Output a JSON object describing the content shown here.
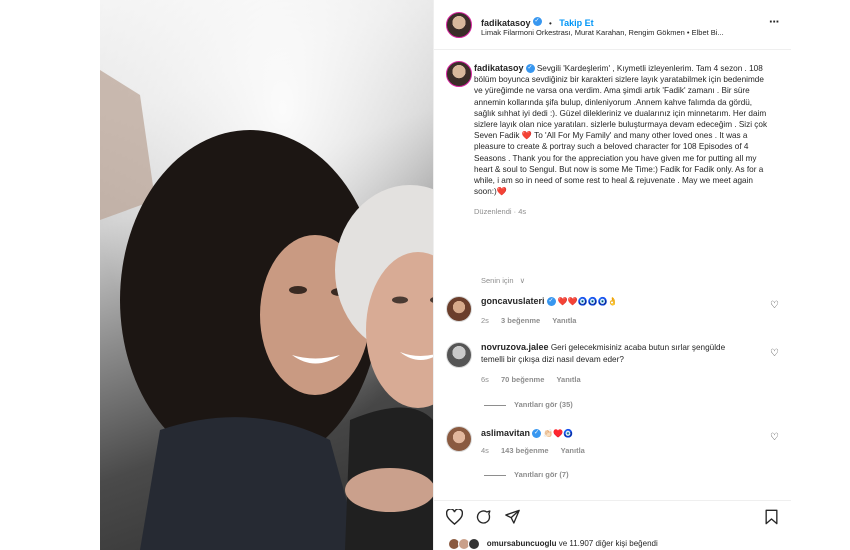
{
  "post": {
    "author": "fadikatasoy",
    "follow_label": "Takip Et",
    "separator": "•",
    "location": "Limak Filarmoni Orkestrası, Murat Karahan, Rengim Gökmen • Elbet Bi...",
    "more_label": "···",
    "caption": "Sevgili 'Kardeşlerim' , Kıymetli izleyenlerim. Tam 4 sezon . 108 bölüm boyunca sevdiğiniz bir karakteri sizlere layık yaratabilmek için bedenimde ve yüreğimde ne varsa ona verdim. Ama şimdi artık 'Fadik' zamanı . Bir süre annemin kollarında şifa bulup, dinleniyorum .Annem kahve falımda da gördü, sağlık sıhhat iyi dedi :). Güzel dilekleriniz ve dualarınız için minnetarım. Her daim sizlere layık olan nice yaratıları. sizlerle buluşturmaya devam edeceğim . Sizi çok Seven Fadik ❤️ To 'All For My Family' and many other loved ones . It was a pleasure to create & portray such a beloved character for 108 Episodes of 4 Seasons . Thank you for the appreciation you have given me for putting all my heart & soul to Sengul. But now is some Me Time:) Fadik for Fadik only. As for a while, i am so in need of some rest to heal & rejuvenate . May we meet again soon:)❤️",
    "edited": "Düzenlendi · 4s",
    "for_you": "Senin için",
    "for_you_chevron": "∨"
  },
  "comments": [
    {
      "user": "goncavuslateri",
      "text": "❤️❤️🧿🧿🧿👌",
      "time": "2s",
      "likes": "3 beğenme",
      "reply": "Yanıtla",
      "verified": true
    },
    {
      "user": "novruzova.jalee",
      "text": "Geri gelecekmisiniz acaba butun sırlar şengülde temelli bir çıkışa dizi nasıl devam eder?",
      "time": "6s",
      "likes": "70 beğenme",
      "reply": "Yanıtla",
      "view_replies": "Yanıtları gör (35)",
      "verified": false
    },
    {
      "user": "aslimavitan",
      "text": "👏🏻♥️🧿",
      "time": "4s",
      "likes": "143 beğenme",
      "reply": "Yanıtla",
      "view_replies": "Yanıtları gör (7)",
      "verified": true
    }
  ],
  "footer": {
    "liked_by_user": "omursabuncuoglu",
    "liked_by_rest": " ve 11.907 diğer kişi beğendi"
  },
  "icons": {
    "like": "heart-icon",
    "comment": "comment-icon",
    "share": "share-icon",
    "save": "bookmark-icon"
  }
}
